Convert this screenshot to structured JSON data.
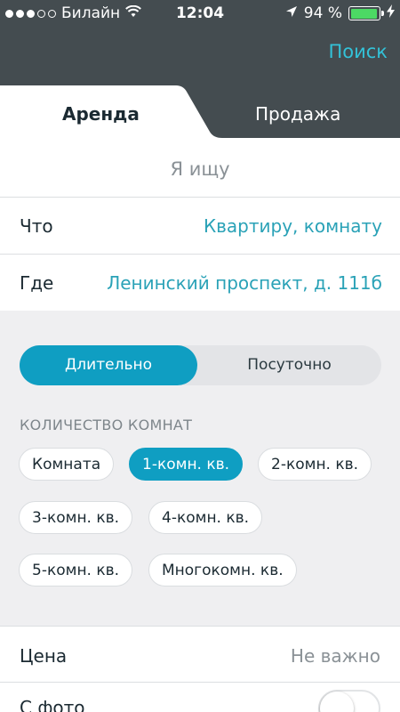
{
  "status_bar": {
    "carrier": "Билайн",
    "time": "12:04",
    "battery_percent": "94 %",
    "battery_level": 0.94,
    "signal_dots_filled": 3,
    "signal_dots_total": 5,
    "icons": [
      "wifi-icon",
      "location-arrow-icon",
      "battery-icon",
      "charging-bolt-icon"
    ]
  },
  "nav": {
    "search_link": "Поиск"
  },
  "tabs": [
    {
      "label": "Аренда",
      "active": true
    },
    {
      "label": "Продажа",
      "active": false
    }
  ],
  "looking_for": "Я ищу",
  "criteria": {
    "what_label": "Что",
    "what_value": "Квартиру, комнату",
    "where_label": "Где",
    "where_value": "Ленинский проспект, д. 111б"
  },
  "rental_period": {
    "options": [
      "Длительно",
      "Посуточно"
    ],
    "selected": "Длительно"
  },
  "rooms": {
    "title": "КОЛИЧЕСТВО КОМНАТ",
    "options": [
      "Комната",
      "1-комн. кв.",
      "2-комн. кв.",
      "3-комн. кв.",
      "4-комн. кв.",
      "5-комн. кв.",
      "Многокомн. кв."
    ],
    "selected": "1-комн. кв."
  },
  "price": {
    "label": "Цена",
    "value": "Не важно"
  },
  "photo": {
    "label": "С фото",
    "enabled": false
  },
  "colors": {
    "accent": "#0f9ec2",
    "link": "#2aa2b7",
    "header_bg": "#444c50",
    "filter_bg": "#efeff1"
  }
}
